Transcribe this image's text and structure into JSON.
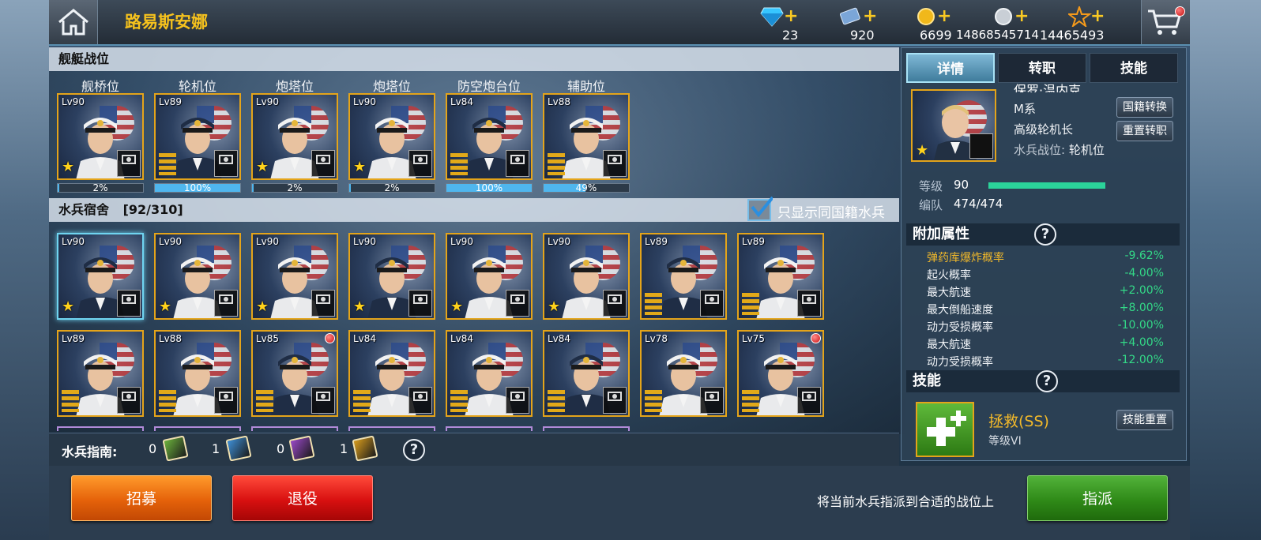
{
  "header": {
    "ship_name": "路易斯安娜",
    "resources": [
      {
        "icon": "diamond-icon",
        "value": "23",
        "color": "#37c6ff"
      },
      {
        "icon": "ticket-icon",
        "value": "920",
        "color": "#7ba6d8"
      },
      {
        "icon": "gold-coin-icon",
        "value": "6699",
        "color": "#f1b81a"
      },
      {
        "icon": "silver-coin-icon",
        "value": "14868545714",
        "color": "#c9cfd6"
      },
      {
        "icon": "star-icon",
        "value": "14465493",
        "color": "#f59a1b"
      }
    ]
  },
  "berths": {
    "title": "舰艇战位",
    "positions": [
      {
        "label": "舰桥位",
        "lv": "Lv90",
        "rank": "star",
        "progress_text": "2%",
        "progress": 0.02
      },
      {
        "label": "轮机位",
        "lv": "Lv89",
        "rank": "chevron",
        "progress_text": "100%",
        "progress": 1.0
      },
      {
        "label": "炮塔位",
        "lv": "Lv90",
        "rank": "star",
        "progress_text": "2%",
        "progress": 0.02
      },
      {
        "label": "炮塔位",
        "lv": "Lv90",
        "rank": "star",
        "progress_text": "2%",
        "progress": 0.02
      },
      {
        "label": "防空炮台位",
        "lv": "Lv84",
        "rank": "chevron",
        "progress_text": "100%",
        "progress": 1.0
      },
      {
        "label": "辅助位",
        "lv": "Lv88",
        "rank": "chevron",
        "progress_text": "49%",
        "progress": 0.49
      }
    ]
  },
  "dorm": {
    "title": "水兵宿舍",
    "count": "[92/310]",
    "filter_label": "只显示同国籍水兵",
    "row1": [
      {
        "lv": "Lv90",
        "rank": "star",
        "selected": true
      },
      {
        "lv": "Lv90",
        "rank": "star"
      },
      {
        "lv": "Lv90",
        "rank": "star"
      },
      {
        "lv": "Lv90",
        "rank": "star"
      },
      {
        "lv": "Lv90",
        "rank": "star"
      },
      {
        "lv": "Lv90",
        "rank": "star"
      },
      {
        "lv": "Lv89",
        "rank": "chevron"
      },
      {
        "lv": "Lv89",
        "rank": "chevron"
      }
    ],
    "row2": [
      {
        "lv": "Lv89",
        "rank": "chevron"
      },
      {
        "lv": "Lv88",
        "rank": "chevron"
      },
      {
        "lv": "Lv85",
        "rank": "chevron",
        "dot": true
      },
      {
        "lv": "Lv84",
        "rank": "chevron"
      },
      {
        "lv": "Lv84",
        "rank": "chevron"
      },
      {
        "lv": "Lv84",
        "rank": "chevron"
      },
      {
        "lv": "Lv78",
        "rank": "chevron"
      },
      {
        "lv": "Lv75",
        "rank": "chevron",
        "dot": true
      }
    ]
  },
  "guide": {
    "title": "水兵指南:",
    "items": [
      {
        "count": "0",
        "color": "#6cb23c"
      },
      {
        "count": "1",
        "color": "#3e8fd6"
      },
      {
        "count": "0",
        "color": "#9a48c8"
      },
      {
        "count": "1",
        "color": "#d89c1c"
      }
    ]
  },
  "actions": {
    "recruit": "招募",
    "retire": "退役",
    "hint": "将当前水兵指派到合适的战位上",
    "assign": "指派"
  },
  "detail": {
    "tabs": [
      "详情",
      "转职",
      "技能"
    ],
    "name_partial": "保罗·温内克",
    "faction": "M系",
    "title": "高级轮机长",
    "position_label": "水兵战位:",
    "position_value": "轮机位",
    "btn_nation": "国籍转换",
    "btn_reset_class": "重置转职",
    "level_label": "等级",
    "level_value": "90",
    "team_label": "编队",
    "team_value": "474/474",
    "attr_title": "附加属性",
    "attrs": [
      {
        "name": "弹药库爆炸概率",
        "value": "-9.62%",
        "highlight": true
      },
      {
        "name": "起火概率",
        "value": "-4.00%"
      },
      {
        "name": "最大航速",
        "value": "+2.00%"
      },
      {
        "name": "最大倒船速度",
        "value": "+8.00%"
      },
      {
        "name": "动力受损概率",
        "value": "-10.00%"
      },
      {
        "name": "最大航速",
        "value": "+4.00%"
      },
      {
        "name": "动力受损概率",
        "value": "-12.00%"
      }
    ],
    "skill_title": "技能",
    "skill_name": "拯救(SS)",
    "skill_level": "等级VI",
    "skill_reset": "技能重置"
  }
}
